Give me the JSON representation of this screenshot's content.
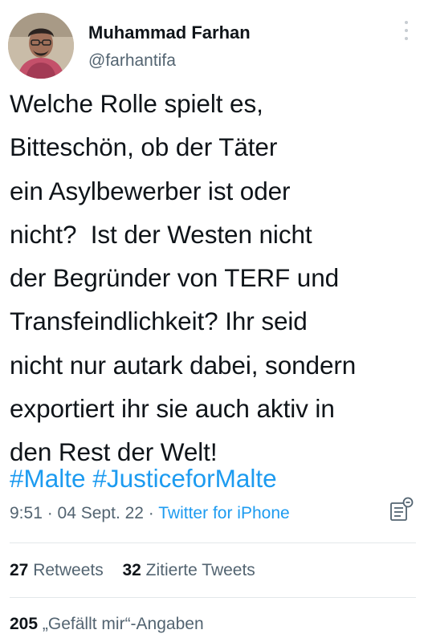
{
  "author": {
    "name": "Muhammad Farhan",
    "handle": "@farhantifa"
  },
  "tweet": {
    "lines": [
      "Welche Rolle spielt es,",
      "Bitteschön, ob der Täter",
      "ein Asylbewerber ist oder",
      "nicht?  Ist der Westen nicht",
      "der Begründer von TERF und",
      "Transfeindlichkeit? Ihr seid",
      "nicht nur autark dabei, sondern",
      "exportiert ihr sie auch aktiv in",
      "den Rest der Welt!"
    ],
    "hashtags": [
      "#Malte",
      "#JusticeforMalte"
    ]
  },
  "meta": {
    "time": "9:51",
    "separator": " · ",
    "date": "04 Sept. 22",
    "source": "Twitter for iPhone"
  },
  "stats": {
    "retweets_count": "27",
    "retweets_label": "Retweets",
    "quotes_count": "32",
    "quotes_label": "Zitierte Tweets",
    "likes_count": "205",
    "likes_label": "„Gefällt mir“-Angaben"
  },
  "icons": {
    "more": "more-vertical-icon",
    "analytics": "analytics-icon"
  },
  "colors": {
    "link": "#1d9bf0",
    "text": "#0f1419",
    "secondary": "#536471",
    "divider": "#e3e7ea"
  }
}
